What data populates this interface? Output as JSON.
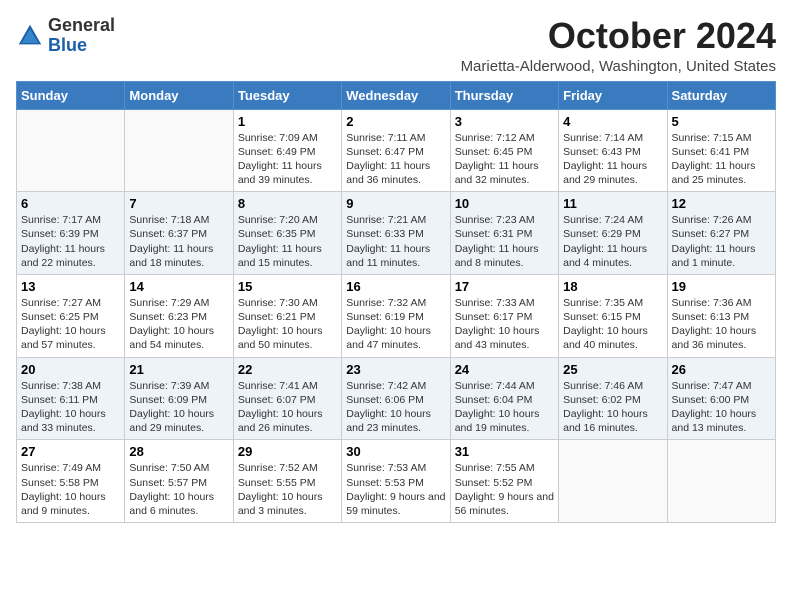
{
  "header": {
    "logo_line1": "General",
    "logo_line2": "Blue",
    "month": "October 2024",
    "location": "Marietta-Alderwood, Washington, United States"
  },
  "weekdays": [
    "Sunday",
    "Monday",
    "Tuesday",
    "Wednesday",
    "Thursday",
    "Friday",
    "Saturday"
  ],
  "weeks": [
    [
      {
        "day": "",
        "info": ""
      },
      {
        "day": "",
        "info": ""
      },
      {
        "day": "1",
        "info": "Sunrise: 7:09 AM\nSunset: 6:49 PM\nDaylight: 11 hours and 39 minutes."
      },
      {
        "day": "2",
        "info": "Sunrise: 7:11 AM\nSunset: 6:47 PM\nDaylight: 11 hours and 36 minutes."
      },
      {
        "day": "3",
        "info": "Sunrise: 7:12 AM\nSunset: 6:45 PM\nDaylight: 11 hours and 32 minutes."
      },
      {
        "day": "4",
        "info": "Sunrise: 7:14 AM\nSunset: 6:43 PM\nDaylight: 11 hours and 29 minutes."
      },
      {
        "day": "5",
        "info": "Sunrise: 7:15 AM\nSunset: 6:41 PM\nDaylight: 11 hours and 25 minutes."
      }
    ],
    [
      {
        "day": "6",
        "info": "Sunrise: 7:17 AM\nSunset: 6:39 PM\nDaylight: 11 hours and 22 minutes."
      },
      {
        "day": "7",
        "info": "Sunrise: 7:18 AM\nSunset: 6:37 PM\nDaylight: 11 hours and 18 minutes."
      },
      {
        "day": "8",
        "info": "Sunrise: 7:20 AM\nSunset: 6:35 PM\nDaylight: 11 hours and 15 minutes."
      },
      {
        "day": "9",
        "info": "Sunrise: 7:21 AM\nSunset: 6:33 PM\nDaylight: 11 hours and 11 minutes."
      },
      {
        "day": "10",
        "info": "Sunrise: 7:23 AM\nSunset: 6:31 PM\nDaylight: 11 hours and 8 minutes."
      },
      {
        "day": "11",
        "info": "Sunrise: 7:24 AM\nSunset: 6:29 PM\nDaylight: 11 hours and 4 minutes."
      },
      {
        "day": "12",
        "info": "Sunrise: 7:26 AM\nSunset: 6:27 PM\nDaylight: 11 hours and 1 minute."
      }
    ],
    [
      {
        "day": "13",
        "info": "Sunrise: 7:27 AM\nSunset: 6:25 PM\nDaylight: 10 hours and 57 minutes."
      },
      {
        "day": "14",
        "info": "Sunrise: 7:29 AM\nSunset: 6:23 PM\nDaylight: 10 hours and 54 minutes."
      },
      {
        "day": "15",
        "info": "Sunrise: 7:30 AM\nSunset: 6:21 PM\nDaylight: 10 hours and 50 minutes."
      },
      {
        "day": "16",
        "info": "Sunrise: 7:32 AM\nSunset: 6:19 PM\nDaylight: 10 hours and 47 minutes."
      },
      {
        "day": "17",
        "info": "Sunrise: 7:33 AM\nSunset: 6:17 PM\nDaylight: 10 hours and 43 minutes."
      },
      {
        "day": "18",
        "info": "Sunrise: 7:35 AM\nSunset: 6:15 PM\nDaylight: 10 hours and 40 minutes."
      },
      {
        "day": "19",
        "info": "Sunrise: 7:36 AM\nSunset: 6:13 PM\nDaylight: 10 hours and 36 minutes."
      }
    ],
    [
      {
        "day": "20",
        "info": "Sunrise: 7:38 AM\nSunset: 6:11 PM\nDaylight: 10 hours and 33 minutes."
      },
      {
        "day": "21",
        "info": "Sunrise: 7:39 AM\nSunset: 6:09 PM\nDaylight: 10 hours and 29 minutes."
      },
      {
        "day": "22",
        "info": "Sunrise: 7:41 AM\nSunset: 6:07 PM\nDaylight: 10 hours and 26 minutes."
      },
      {
        "day": "23",
        "info": "Sunrise: 7:42 AM\nSunset: 6:06 PM\nDaylight: 10 hours and 23 minutes."
      },
      {
        "day": "24",
        "info": "Sunrise: 7:44 AM\nSunset: 6:04 PM\nDaylight: 10 hours and 19 minutes."
      },
      {
        "day": "25",
        "info": "Sunrise: 7:46 AM\nSunset: 6:02 PM\nDaylight: 10 hours and 16 minutes."
      },
      {
        "day": "26",
        "info": "Sunrise: 7:47 AM\nSunset: 6:00 PM\nDaylight: 10 hours and 13 minutes."
      }
    ],
    [
      {
        "day": "27",
        "info": "Sunrise: 7:49 AM\nSunset: 5:58 PM\nDaylight: 10 hours and 9 minutes."
      },
      {
        "day": "28",
        "info": "Sunrise: 7:50 AM\nSunset: 5:57 PM\nDaylight: 10 hours and 6 minutes."
      },
      {
        "day": "29",
        "info": "Sunrise: 7:52 AM\nSunset: 5:55 PM\nDaylight: 10 hours and 3 minutes."
      },
      {
        "day": "30",
        "info": "Sunrise: 7:53 AM\nSunset: 5:53 PM\nDaylight: 9 hours and 59 minutes."
      },
      {
        "day": "31",
        "info": "Sunrise: 7:55 AM\nSunset: 5:52 PM\nDaylight: 9 hours and 56 minutes."
      },
      {
        "day": "",
        "info": ""
      },
      {
        "day": "",
        "info": ""
      }
    ]
  ]
}
